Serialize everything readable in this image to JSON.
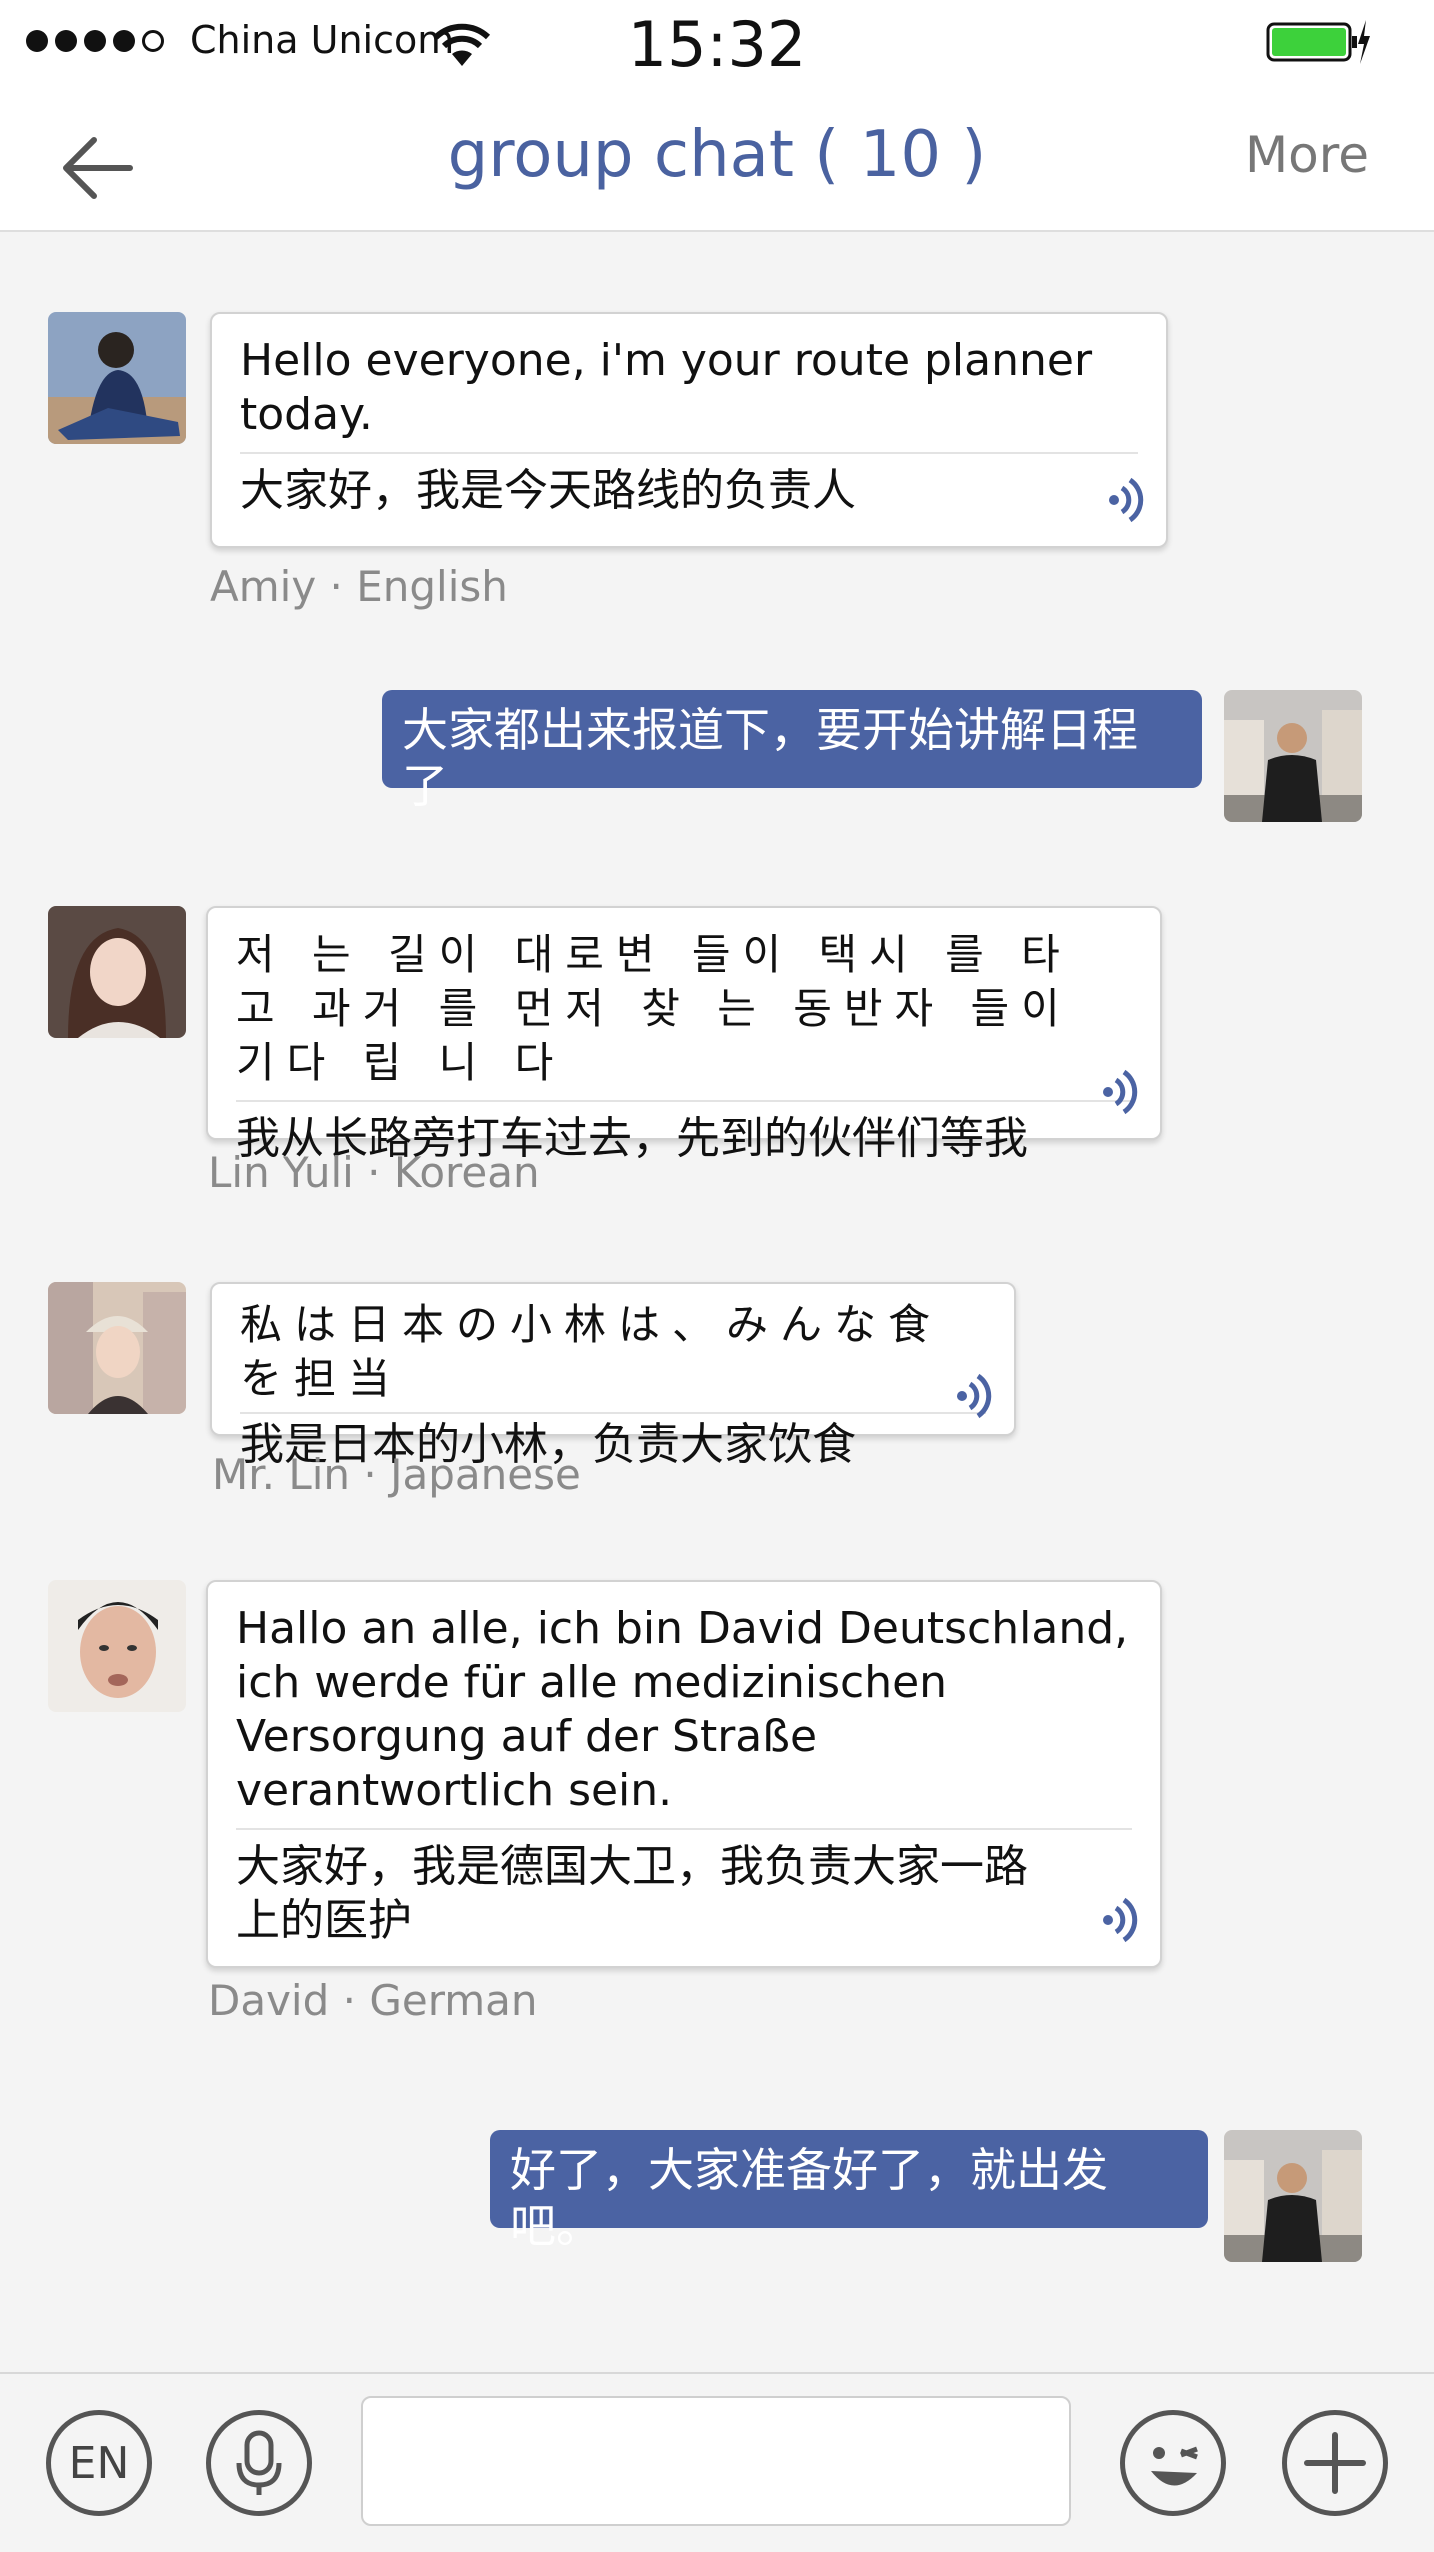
{
  "status_bar": {
    "carrier": "China Unicom",
    "time": "15:32",
    "signal_bars_filled": 4,
    "signal_bars_total": 5
  },
  "header": {
    "back_icon": "arrow-left-icon",
    "title": "group chat ( 10 )",
    "more_label": "More"
  },
  "messages": [
    {
      "sender": "Amiy",
      "language": "English",
      "sender_line": "Amiy  · English",
      "original": "Hello everyone, i'm your route planner today.",
      "translation": "大家好，我是今天路线的负责人"
    },
    {
      "mine": true,
      "text": "大家都出来报道下，要开始讲解日程了"
    },
    {
      "sender": "Lin Yuli",
      "language": "Korean",
      "sender_line": "Lin Yuli · Korean",
      "original": "저 는 길이 대로변 들이 택시 를 타 고 과거 를 먼저 찾 는 동반자 들이 기다 립 니 다",
      "translation": "我从长路旁打车过去，先到的伙伴们等我"
    },
    {
      "sender": "Mr. Lin",
      "language": "Japanese",
      "sender_line": "Mr. Lin · Japanese",
      "original": "私は日本の小林は、みんな食を担当",
      "translation": "我是日本的小林，负责大家饮食"
    },
    {
      "sender": "David",
      "language": "German",
      "sender_line": "David · German",
      "original": "Hallo an alle, ich bin David Deutschland, ich werde für alle medizinischen Versorgung auf der Straße verantwortlich sein.",
      "translation": "大家好，我是德国大卫，我负责大家一路上的医护"
    },
    {
      "mine": true,
      "text": "好了，大家准备好了，就出发吧。"
    }
  ],
  "input_bar": {
    "language_button": "EN",
    "mic_icon": "microphone-icon",
    "emoji_icon": "wink-emoji-icon",
    "add_icon": "plus-icon",
    "input_value": "",
    "input_placeholder": ""
  },
  "colors": {
    "accent": "#4b63a3",
    "title": "#4a62a0",
    "battery": "#3dd13b"
  }
}
